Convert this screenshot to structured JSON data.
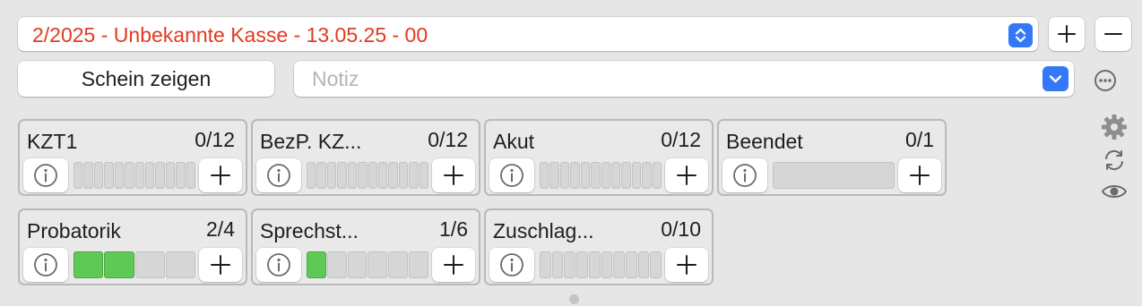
{
  "case_select": {
    "value": "2/2025 - Unbekannte Kasse - 13.05.25 - 00",
    "text_color": "#e23a22"
  },
  "buttons": {
    "add_icon": "plus-icon",
    "remove_icon": "minus-icon"
  },
  "schein_button": {
    "label": "Schein zeigen"
  },
  "notiz": {
    "placeholder": "Notiz",
    "value": ""
  },
  "side_icons": [
    "more-icon",
    "gear-icon",
    "refresh-icon",
    "eye-icon"
  ],
  "colors": {
    "accent": "#3478f6",
    "filled": "#5fc955",
    "empty": "#d6d6d6"
  },
  "cards": [
    {
      "label": "KZT1",
      "count": "0/12",
      "used": 0,
      "total": 12
    },
    {
      "label": "BezP. KZ...",
      "count": "0/12",
      "used": 0,
      "total": 12
    },
    {
      "label": "Akut",
      "count": "0/12",
      "used": 0,
      "total": 12
    },
    {
      "label": "Beendet",
      "count": "0/1",
      "used": 0,
      "total": 1
    },
    {
      "label": "Probatorik",
      "count": "2/4",
      "used": 2,
      "total": 4
    },
    {
      "label": "Sprechst...",
      "count": "1/6",
      "used": 1,
      "total": 6
    },
    {
      "label": "Zuschlag...",
      "count": "0/10",
      "used": 0,
      "total": 10
    }
  ]
}
